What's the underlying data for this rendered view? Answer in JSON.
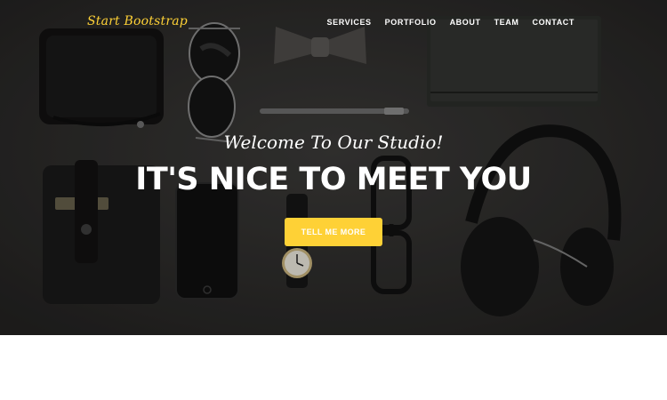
{
  "navbar": {
    "brand": "Start Bootstrap",
    "links": [
      "SERVICES",
      "PORTFOLIO",
      "ABOUT",
      "TEAM",
      "CONTACT"
    ]
  },
  "hero": {
    "lead": "Welcome To Our Studio!",
    "heading": "IT'S NICE TO MEET YOU",
    "cta_label": "TELL ME MORE"
  },
  "colors": {
    "accent": "#fed136",
    "hero_background": "#302f2d",
    "page_background": "#ffffff"
  }
}
